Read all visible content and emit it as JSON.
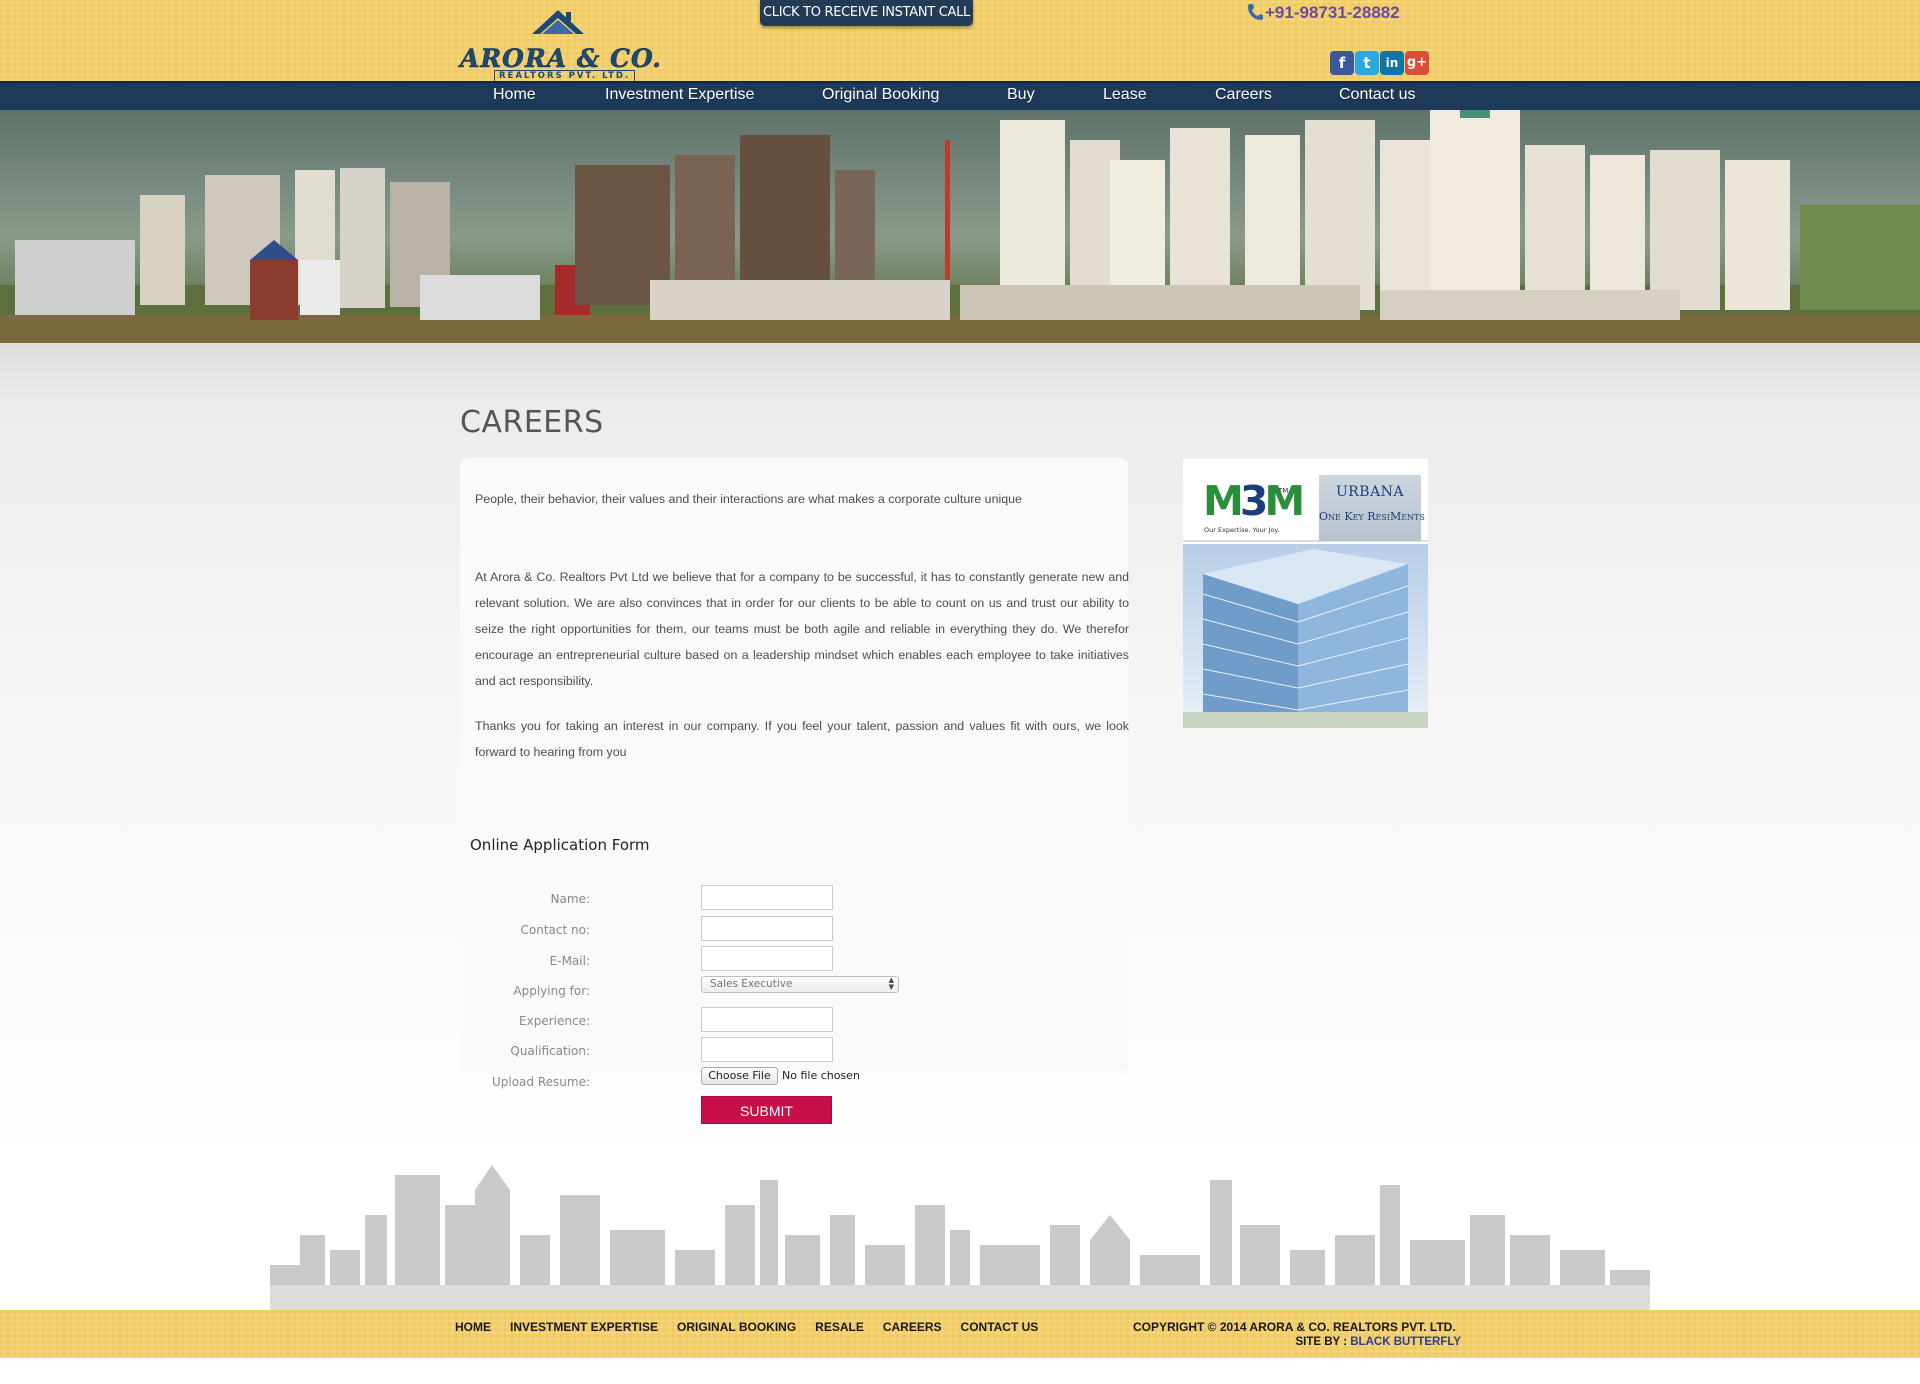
{
  "header": {
    "logo_name": "ARORA & CO.",
    "logo_sub": "REALTORS PVT. LTD.",
    "call_button": "CLICK TO RECEIVE INSTANT CALL",
    "phone": "+91-98731-28882",
    "social": [
      {
        "label": "f",
        "icon": "facebook-icon",
        "color": "#3b5998"
      },
      {
        "label": "t",
        "icon": "twitter-icon",
        "color": "#29a9e1"
      },
      {
        "label": "in",
        "icon": "linkedin-icon",
        "color": "#0e76a8"
      },
      {
        "label": "g+",
        "icon": "google-plus-icon",
        "color": "#dd4b39"
      }
    ]
  },
  "nav": {
    "items": [
      "Home",
      "Investment Expertise",
      "Original Booking",
      "Buy",
      "Lease",
      "Careers",
      "Contact us"
    ]
  },
  "main": {
    "title": "CAREERS",
    "paragraphs": [
      "People, their behavior, their values and their interactions are what makes a corporate culture unique",
      "At Arora & Co. Realtors Pvt Ltd we believe that for a company to be successful, it has to constantly generate new and relevant solution. We are also convinces that in order for our clients to be able to count on us and trust our ability to seize the right opportunities for them, our teams must be both agile and reliable in everything they do. We therefor encourage an entrepreneurial culture based on a leadership mindset which enables each employee to take initiatives and act responsibility.",
      "Thanks you for taking an interest in our company. If you feel your talent, passion and values fit with ours, we look forward to hearing from you"
    ],
    "form": {
      "title": "Online Application Form",
      "labels": {
        "name": "Name:",
        "contact": "Contact no:",
        "email": "E-Mail:",
        "applying": "Applying for:",
        "experience": "Experience:",
        "qualification": "Qualification:",
        "resume": "Upload Resume:"
      },
      "applying_selected": "Sales Executive",
      "file_button": "Choose File",
      "file_status": "No file chosen",
      "submit": "SUBMIT"
    }
  },
  "ad": {
    "brand": "M3M",
    "brand_tm": "TM",
    "brand_tagline": "Our Expertise. Your Joy.",
    "project_name": "URBANA",
    "project_tagline": "One Key ResiMents"
  },
  "footer": {
    "links": [
      "HOME",
      "INVESTMENT EXPERTISE",
      "ORIGINAL BOOKING",
      "RESALE",
      "CAREERS",
      "CONTACT US"
    ],
    "copyright": "COPYRIGHT © 2014 ARORA & CO. REALTORS PVT. LTD.",
    "site_by_label": "SITE BY :",
    "site_by_credit": "BLACK BUTTERFLY"
  },
  "colors": {
    "header_bg": "#f2cf6a",
    "nav_bg": "#1d3a58",
    "submit_bg": "#c70f49",
    "phone_text": "#6a4aa8"
  }
}
